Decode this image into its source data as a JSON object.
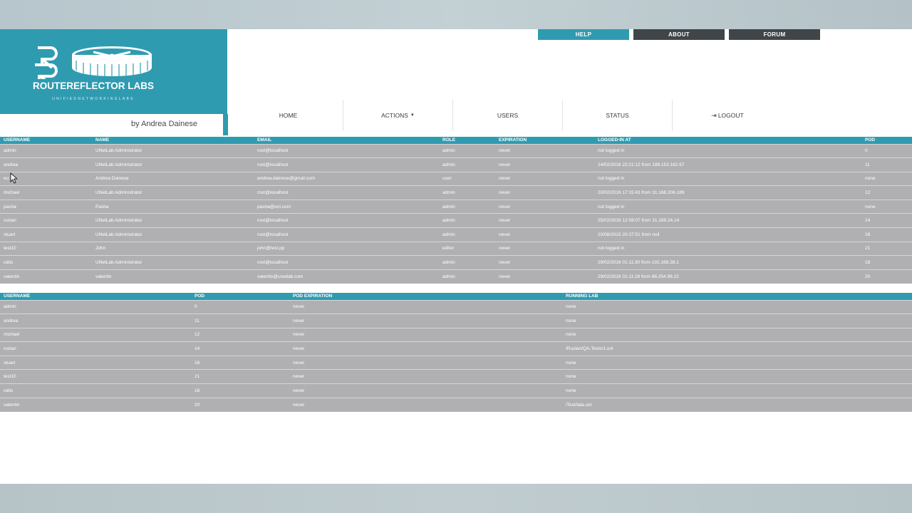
{
  "brand": {
    "logo_text": "ROUTEREFLECTOR LABS",
    "logo_tagline": "UNIFIEDNETWORKINGLABS",
    "byline": "by Andrea Dainese"
  },
  "toplinks": [
    {
      "label": "HELP",
      "icon": "help-link"
    },
    {
      "label": "ABOUT",
      "icon": "about-link"
    },
    {
      "label": "FORUM",
      "icon": "forum-link"
    }
  ],
  "nav": {
    "home": "HOME",
    "actions": "ACTIONS",
    "users": "USERS",
    "status": "STATUS",
    "logout": "LOGOUT"
  },
  "colors": {
    "accent": "#2f9bb0",
    "dark_button": "#3f4549",
    "row_bg": "#b0b0b2"
  },
  "users_table": {
    "headers": [
      "USERNAME",
      "NAME",
      "EMAIL",
      "ROLE",
      "EXPIRATION",
      "LOGGED-IN AT",
      "POD"
    ],
    "rows": [
      [
        "admin",
        "UNetLab Administrator",
        "root@localhost",
        "admin",
        "never",
        "not logged in",
        "0"
      ],
      [
        "andrea",
        "UNetLab Administrator",
        "root@localhost",
        "admin",
        "never",
        "14/02/2016 22:21:12 from 188.153.162.67",
        "11"
      ],
      [
        "eu",
        "Andrea Dainese",
        "andrea.dainese@gmail.com",
        "user",
        "never",
        "not logged in",
        "none"
      ],
      [
        "michael",
        "UNetLab Administrator",
        "root@localhost",
        "admin",
        "never",
        "20/02/2016 17:15:43 from 31.168.206.189",
        "12"
      ],
      [
        "pasha",
        "Pasha",
        "pasha@unl.com",
        "admin",
        "never",
        "not logged in",
        "none"
      ],
      [
        "ruslan",
        "UNetLab Administrator",
        "root@localhost",
        "admin",
        "never",
        "25/02/2016 12:59:07 from 31.168.24.14",
        "14"
      ],
      [
        "stuart",
        "UNetLab Administrator",
        "root@localhost",
        "admin",
        "never",
        "10/08/2015 20:37:51 from null",
        "16"
      ],
      [
        "test10",
        "John",
        "john@test.pp",
        "editor",
        "never",
        "not logged in",
        "21"
      ],
      [
        "uldis",
        "UNetLab Administrator",
        "root@localhost",
        "admin",
        "never",
        "29/02/2016 01:11:30 from 192.168.28.1",
        "18"
      ],
      [
        "valentin",
        "valentin",
        "valentin@unetlab.com",
        "admin",
        "never",
        "29/02/2016 01:11:28 from 88.254.99.22",
        "20"
      ]
    ]
  },
  "pods_table": {
    "headers": [
      "USERNAME",
      "POD",
      "POD EXPIRATION",
      "RUNNING LAB"
    ],
    "rows": [
      [
        "admin",
        "0",
        "never",
        "none"
      ],
      [
        "andrea",
        "11",
        "never",
        "none"
      ],
      [
        "michael",
        "12",
        "never",
        "none"
      ],
      [
        "ruslan",
        "14",
        "never",
        "/Ruslan/QA-Tests/1.unl"
      ],
      [
        "stuart",
        "16",
        "never",
        "none"
      ],
      [
        "test10",
        "21",
        "never",
        "none"
      ],
      [
        "uldis",
        "18",
        "never",
        "none"
      ],
      [
        "valentin",
        "20",
        "never",
        "/Test/lala.unl"
      ]
    ]
  }
}
